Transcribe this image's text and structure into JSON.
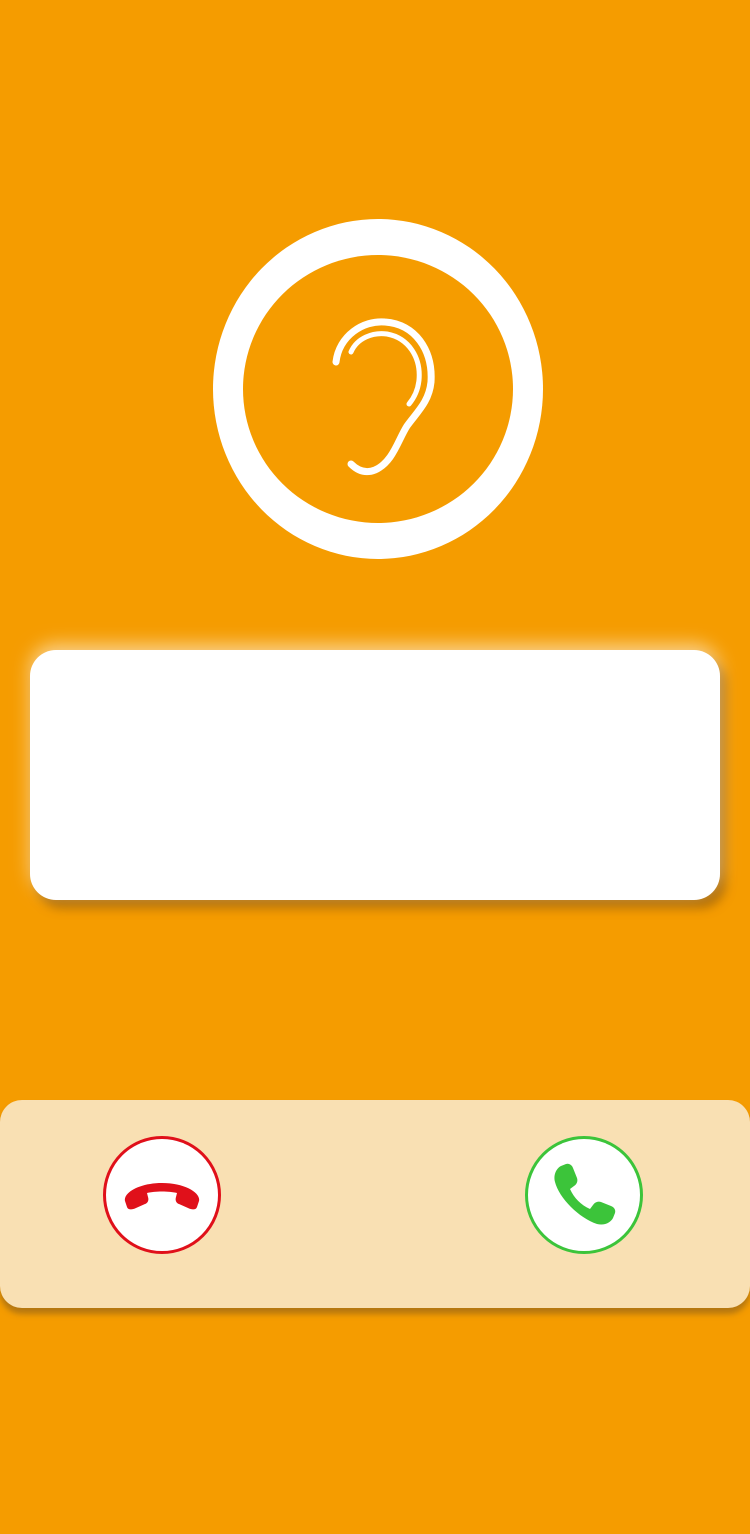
{
  "app": {
    "screen": "incoming-call",
    "background_color": "#f59c00"
  },
  "caller": {
    "avatar_icon": "ear-icon",
    "name": "",
    "status": ""
  },
  "actions": {
    "bar_color": "#f9e0b3",
    "decline": {
      "icon": "phone-hangup-icon",
      "color": "#e0101a"
    },
    "accept": {
      "icon": "phone-answer-icon",
      "color": "#3cc43a"
    }
  }
}
